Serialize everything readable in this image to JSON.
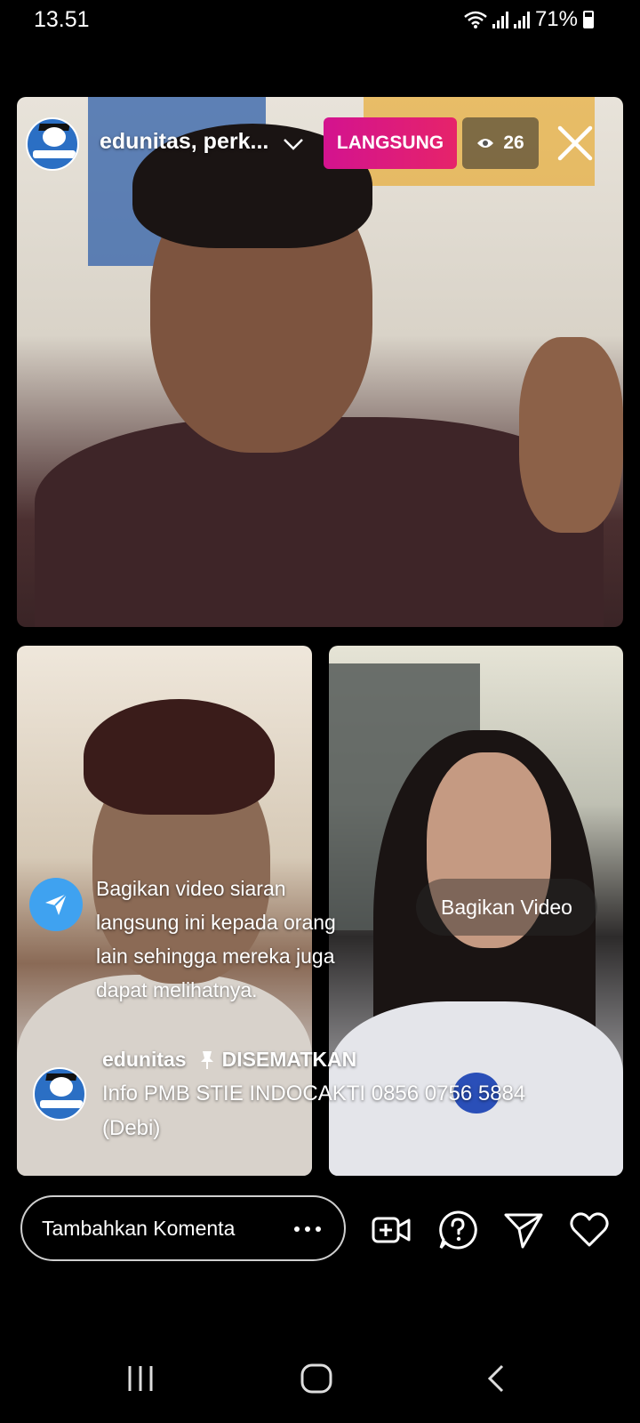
{
  "status_bar": {
    "time": "13.51",
    "battery": "71%"
  },
  "live": {
    "host_name": "edunitas, perk...",
    "live_label": "LANGSUNG",
    "viewer_count": "26"
  },
  "share_prompt": {
    "text": "Bagikan video siaran langsung ini kepada orang lain sehingga mereka juga dapat melihatnya.",
    "button_label": "Bagikan Video"
  },
  "pinned_comment": {
    "username": "edunitas",
    "pinned_label": "DISEMATKAN",
    "text": "Info PMB STIE INDOCAKTI 0856 0756 5884 (Debi)"
  },
  "bottom_bar": {
    "comment_placeholder": "Tambahkan Komenta",
    "icons": [
      "add-video-icon",
      "question-icon",
      "send-icon",
      "heart-icon"
    ]
  },
  "colors": {
    "live_badge": "#d3138f",
    "share_icon_bg": "#3fa2f0"
  }
}
